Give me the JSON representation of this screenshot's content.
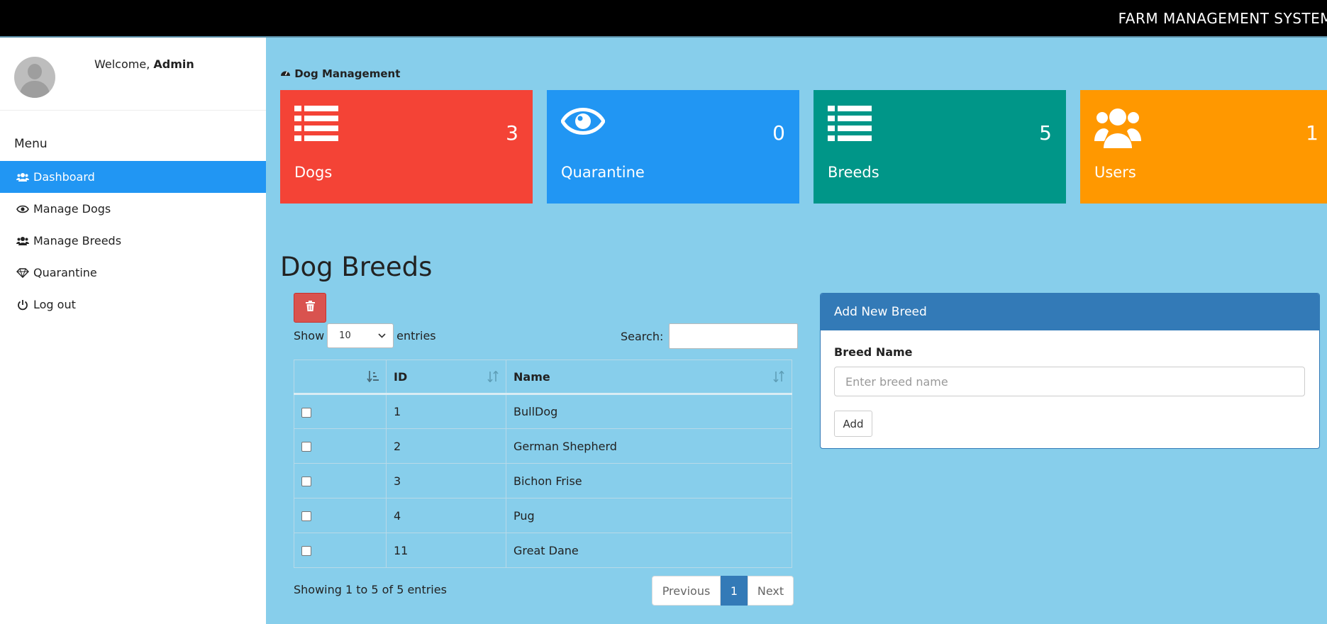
{
  "app": {
    "brand": "FARM MANAGEMENT SYSTEM"
  },
  "sidebar": {
    "welcome_prefix": "Welcome, ",
    "welcome_user": "Admin",
    "menu_title": "Menu",
    "items": [
      {
        "label": "Dashboard",
        "icon": "users-icon",
        "active": true
      },
      {
        "label": "Manage Dogs",
        "icon": "eye-icon",
        "active": false
      },
      {
        "label": "Manage Breeds",
        "icon": "users-icon",
        "active": false
      },
      {
        "label": "Quarantine",
        "icon": "diamond-icon",
        "active": false
      },
      {
        "label": "Log out",
        "icon": "power-icon",
        "active": false
      }
    ]
  },
  "breadcrumb": {
    "label": "Dog Management",
    "icon": "dashboard-icon"
  },
  "tiles": [
    {
      "label": "Dogs",
      "count": "3",
      "color": "#f44336",
      "icon": "list-icon"
    },
    {
      "label": "Quarantine",
      "count": "0",
      "color": "#2196f3",
      "icon": "eye-icon"
    },
    {
      "label": "Breeds",
      "count": "5",
      "color": "#009688",
      "icon": "list-icon"
    },
    {
      "label": "Users",
      "count": "1",
      "color": "#ff9800",
      "icon": "users-icon"
    }
  ],
  "section": {
    "title": "Dog Breeds"
  },
  "table_controls": {
    "show_label": "Show",
    "page_size": "10",
    "entries_label": "entries",
    "search_label": "Search:"
  },
  "table": {
    "headers": [
      "",
      "ID",
      "Name"
    ],
    "rows": [
      {
        "id": "1",
        "name": "BullDog"
      },
      {
        "id": "2",
        "name": "German Shepherd"
      },
      {
        "id": "3",
        "name": "Bichon Frise"
      },
      {
        "id": "4",
        "name": "Pug"
      },
      {
        "id": "11",
        "name": "Great Dane"
      }
    ]
  },
  "pagination": {
    "info": "Showing 1 to 5 of 5 entries",
    "previous": "Previous",
    "current": "1",
    "next": "Next"
  },
  "add_panel": {
    "title": "Add New Breed",
    "field_label": "Breed Name",
    "placeholder": "Enter breed name",
    "button": "Add"
  },
  "colors": {
    "page_bg": "#87ceeb",
    "active_nav": "#2196f3",
    "panel_primary": "#337ab7",
    "danger": "#d9534f"
  }
}
